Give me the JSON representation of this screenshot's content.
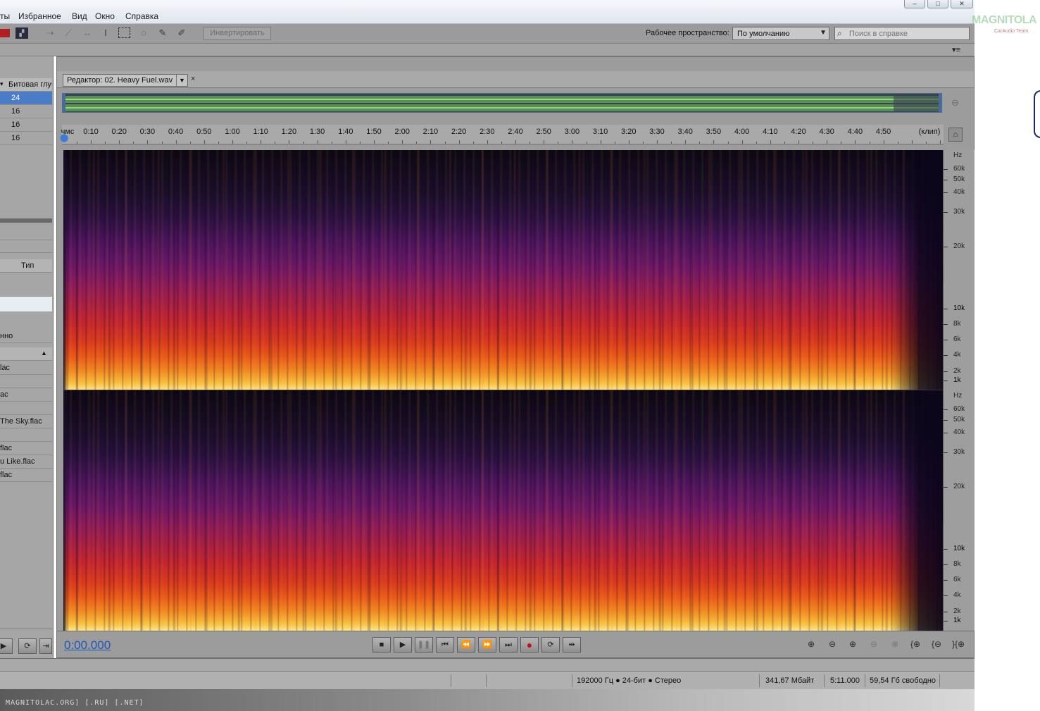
{
  "menu": {
    "items": [
      "ты",
      "Избранное",
      "Вид",
      "Окно",
      "Справка"
    ]
  },
  "toolbar": {
    "invert_label": "Инвертировать",
    "workspace_label": "Рабочее пространство:",
    "workspace_value": "По умолчанию",
    "search_placeholder": "Поиск в справке"
  },
  "left_panel": {
    "bitdepth_header": "Битовая глуб",
    "bitdepth_values": [
      "24",
      "16",
      "16",
      "16"
    ],
    "type_header": "Тип",
    "partial_label": "нно",
    "files": [
      "lac",
      "ac",
      "The Sky.flac",
      "flac",
      "u Like.flac",
      "flac"
    ]
  },
  "editor": {
    "tab_title": "Редактор: 02. Heavy Fuel.wav",
    "ruler_start": "чмс",
    "ruler_end": "(клип)",
    "ruler_labels": [
      "0:10",
      "0:20",
      "0:30",
      "0:40",
      "0:50",
      "1:00",
      "1:10",
      "1:20",
      "1:30",
      "1:40",
      "1:50",
      "2:00",
      "2:10",
      "2:20",
      "2:30",
      "2:40",
      "2:50",
      "3:00",
      "3:10",
      "3:20",
      "3:30",
      "3:40",
      "3:50",
      "4:00",
      "4:10",
      "4:20",
      "4:30",
      "4:40",
      "4:50"
    ],
    "hz_unit": "Hz",
    "hz_labels": [
      "60k",
      "50k",
      "40k",
      "30k",
      "20k",
      "10k",
      "8k",
      "6k",
      "4k",
      "2k",
      "1k"
    ],
    "timecode": "0:00.000"
  },
  "status": {
    "format": "192000 Гц ● 24-бит ● Стерео",
    "size": "341,67 Мбайт",
    "duration": "5:11.000",
    "free": "59,54 Гб свободно"
  },
  "watermark": {
    "text": "MAGNITOLAC.ORG] [.RU] [.NET]",
    "logo": "MAGNITOLA",
    "logo_sub": "CarAudio Team"
  },
  "colors": {
    "timecode": "#1f56b8",
    "record": "#d01010",
    "waveform": "#7cc46a"
  }
}
